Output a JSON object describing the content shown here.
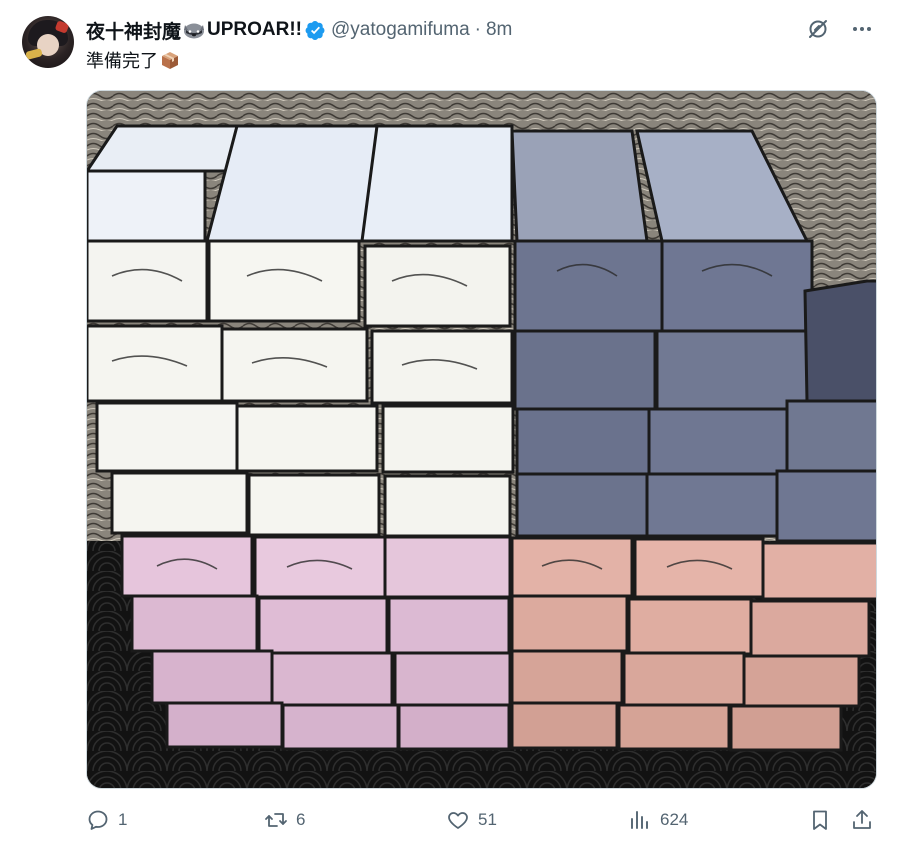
{
  "author": {
    "display_name": "夜十神封魔",
    "display_name_suffix": "UPROAR!!",
    "handle": "@yatogamifuma",
    "separator": "·",
    "time": "8m",
    "verified": true,
    "emoji_icon": "raccoon-icon"
  },
  "tweet": {
    "text": "準備完了",
    "trailing_emoji": "package-icon"
  },
  "media": {
    "description_icon": "photo-of-stacked-card-boxes"
  },
  "actions": {
    "reply_count": "1",
    "retweet_count": "6",
    "like_count": "51",
    "views_count": "624"
  },
  "colors": {
    "text": "#0f1419",
    "secondary": "#536471",
    "verified_blue": "#1d9bf0",
    "border": "#cfd9de"
  }
}
